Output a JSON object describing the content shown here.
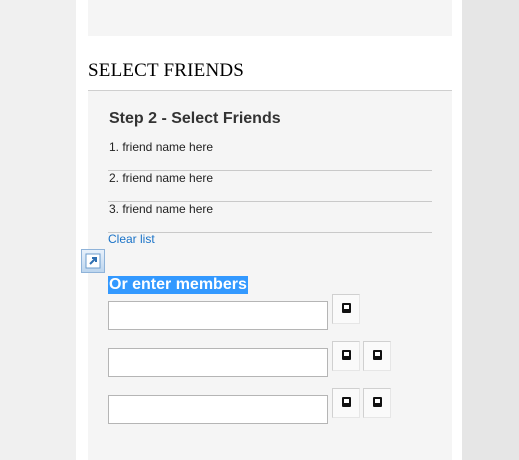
{
  "section": {
    "title": "SELECT FRIENDS"
  },
  "step": {
    "heading": "Step 2 - Select Friends"
  },
  "friends": [
    {
      "label": "1. friend name here"
    },
    {
      "label": "2. friend name here"
    },
    {
      "label": "3. friend name here"
    }
  ],
  "clear_list": {
    "label": "Clear list"
  },
  "or_enter": {
    "label": "Or enter members"
  },
  "member_inputs": [
    {
      "value": "",
      "placeholder": ""
    },
    {
      "value": "",
      "placeholder": ""
    },
    {
      "value": "",
      "placeholder": ""
    }
  ],
  "icons": {
    "popout": "popout-arrow-icon",
    "member_button": "square-icon"
  },
  "colors": {
    "link": "#1a73c8",
    "highlight": "#3399ff"
  }
}
